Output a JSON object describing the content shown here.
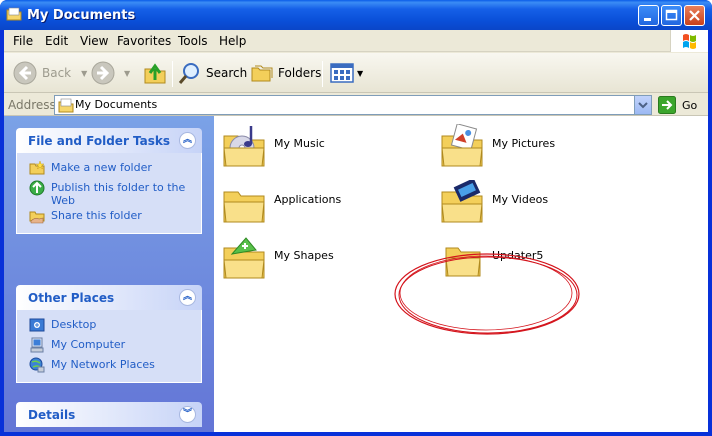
{
  "window": {
    "title": "My Documents"
  },
  "menu": [
    "File",
    "Edit",
    "View",
    "Favorites",
    "Tools",
    "Help"
  ],
  "toolbar": {
    "back": "Back",
    "search": "Search",
    "folders": "Folders"
  },
  "address": {
    "label": "Address",
    "value": "My Documents",
    "go": "Go"
  },
  "taskpane": {
    "file_tasks": {
      "title": "File and Folder Tasks",
      "items": [
        {
          "label": "Make a new folder",
          "icon": "new-folder-icon"
        },
        {
          "label": "Publish this folder to the Web",
          "icon": "publish-web-icon"
        },
        {
          "label": "Share this folder",
          "icon": "share-folder-icon"
        }
      ]
    },
    "other_places": {
      "title": "Other Places",
      "items": [
        {
          "label": "Desktop",
          "icon": "desktop-icon"
        },
        {
          "label": "My Computer",
          "icon": "computer-icon"
        },
        {
          "label": "My Network Places",
          "icon": "network-places-icon"
        }
      ]
    },
    "details": {
      "title": "Details"
    }
  },
  "folders": [
    {
      "label": "My Music",
      "icon": "music-folder-icon"
    },
    {
      "label": "My Pictures",
      "icon": "pictures-folder-icon"
    },
    {
      "label": "Applications",
      "icon": "folder-icon"
    },
    {
      "label": "My Videos",
      "icon": "videos-folder-icon"
    },
    {
      "label": "My Shapes",
      "icon": "shapes-folder-icon"
    },
    {
      "label": "Updater5",
      "icon": "folder-icon"
    }
  ],
  "colors": {
    "titlebar": "#0a4fd8",
    "taskpane": "#7ba2e7",
    "link": "#215dc6",
    "highlight_ellipse": "#d4141c"
  }
}
